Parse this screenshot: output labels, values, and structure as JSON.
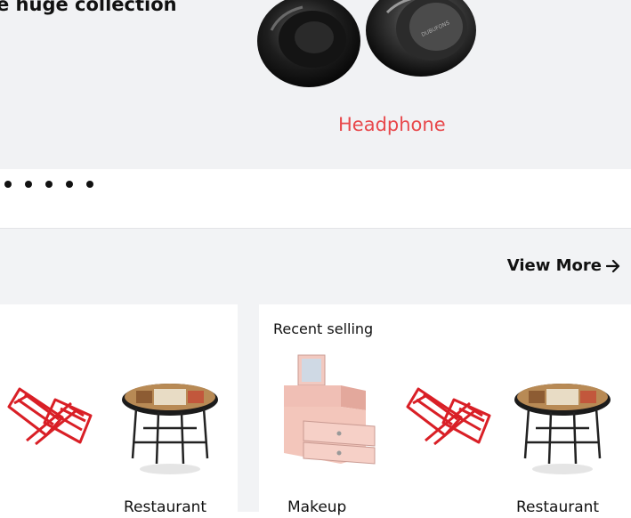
{
  "hero": {
    "tagline": "e huge collection",
    "active_label": "Headphone",
    "dots": 5
  },
  "section": {
    "view_more": "View More",
    "cards": [
      {
        "title": "",
        "products": [
          {
            "name": "",
            "icon": "red-book-stand-icon"
          },
          {
            "name": "Restaurant",
            "icon": "round-table-icon"
          }
        ]
      },
      {
        "title": "Recent selling",
        "products": [
          {
            "name": "Makeup",
            "icon": "makeup-organizer-icon"
          },
          {
            "name": "",
            "icon": "red-book-stand-icon"
          },
          {
            "name": "Restaurant",
            "icon": "round-table-icon"
          }
        ]
      }
    ]
  },
  "colors": {
    "accent": "#e8484b",
    "banner_bg": "#f1f2f4",
    "section_bg": "#f2f3f5"
  }
}
